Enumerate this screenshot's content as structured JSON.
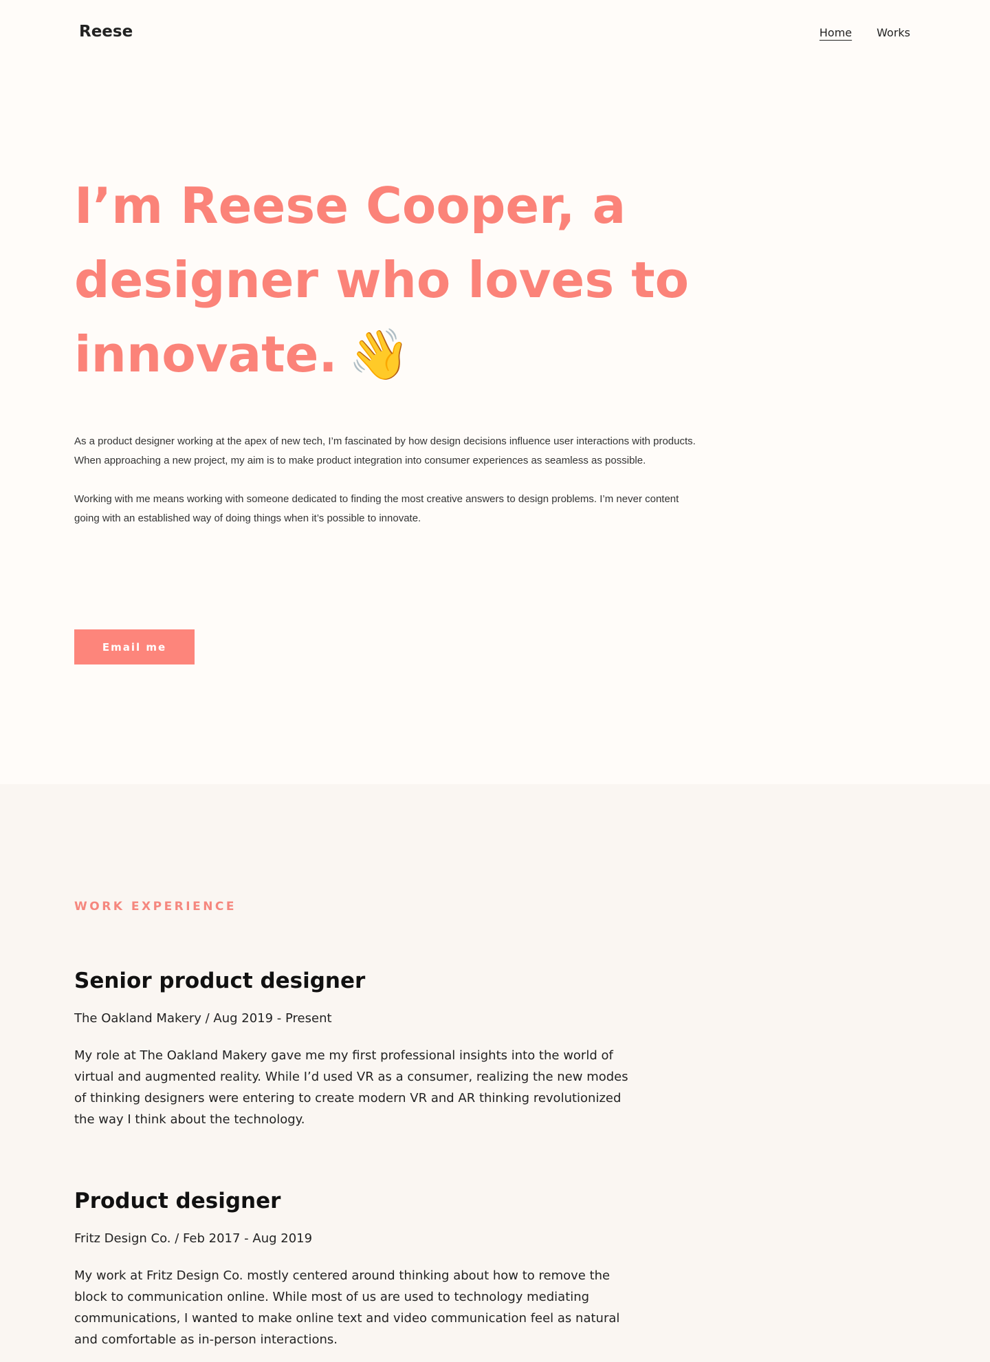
{
  "header": {
    "brand": "Reese",
    "nav": [
      {
        "label": "Home",
        "active": true
      },
      {
        "label": "Works",
        "active": false
      }
    ]
  },
  "hero": {
    "title_line1": "I’m Reese Cooper, a",
    "title_line2": "designer who loves to",
    "title_line3": "innovate.",
    "wave_emoji": "👋",
    "paragraphs": [
      "As a product designer working at the apex of new tech, I’m fascinated by how design decisions influence user interactions with products. When approaching a new project, my aim is to make product integration into consumer experiences as seamless as possible.",
      "Working with me means working with someone dedicated to finding the most creative answers to design problems. I’m never content going with an established way of doing things when it’s possible to innovate."
    ],
    "cta_label": "Email me"
  },
  "work": {
    "label": "WORK EXPERIENCE",
    "jobs": [
      {
        "title": "Senior product designer",
        "meta": "The Oakland Makery / Aug 2019 - Present",
        "description": "My role at The Oakland Makery gave me my first professional insights into the world of virtual and augmented reality. While I’d used VR as a consumer, realizing the new modes of thinking designers were entering to create modern VR and AR thinking revolutionized the way I think about the technology."
      },
      {
        "title": "Product designer",
        "meta": "Fritz Design Co. / Feb 2017 - Aug 2019",
        "description": "My work at Fritz Design Co. mostly centered around thinking about how to remove the block to communication online. While most of us are used to technology mediating communications, I wanted to make online text and video communication feel as natural and comfortable as in-person interactions."
      }
    ]
  },
  "colors": {
    "accent": "#fb8379",
    "background": "#fffcf9",
    "section_background": "#faf6f2"
  }
}
